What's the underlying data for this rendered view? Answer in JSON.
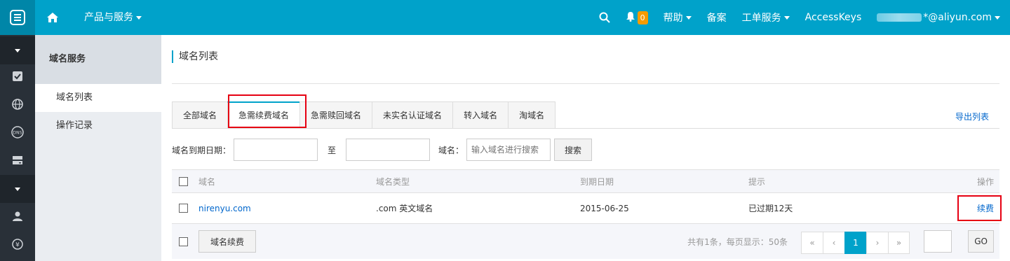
{
  "topbar": {
    "products_label": "产品与服务",
    "notification_count": "0",
    "help_label": "帮助",
    "beian_label": "备案",
    "ticket_label": "工单服务",
    "accesskeys_label": "AccessKeys",
    "account_suffix": "*@aliyun.com"
  },
  "sidebar": {
    "heading": "域名服务",
    "items": [
      {
        "label": "域名列表"
      },
      {
        "label": "操作记录"
      }
    ]
  },
  "main": {
    "title": "域名列表",
    "tabs": [
      {
        "label": "全部域名"
      },
      {
        "label": "急需续费域名"
      },
      {
        "label": "急需赎回域名"
      },
      {
        "label": "未实名认证域名"
      },
      {
        "label": "转入域名"
      },
      {
        "label": "淘域名"
      }
    ],
    "export_label": "导出列表",
    "filter": {
      "expiry_label": "域名到期日期：",
      "to_label": "至",
      "domain_label": "域名：",
      "domain_placeholder": "输入域名进行搜索",
      "search_label": "搜索"
    },
    "table": {
      "columns": [
        "域名",
        "域名类型",
        "到期日期",
        "提示",
        "操作"
      ],
      "rows": [
        {
          "domain": "nirenyu.com",
          "type": ".com 英文域名",
          "expiry": "2015-06-25",
          "hint": "已过期12天",
          "action": "续费"
        }
      ]
    },
    "footer": {
      "renew_button": "域名续费",
      "summary": "共有1条，每页显示：50条",
      "pages": [
        "«",
        "‹",
        "1",
        "›",
        "»"
      ],
      "go_label": "GO"
    }
  }
}
